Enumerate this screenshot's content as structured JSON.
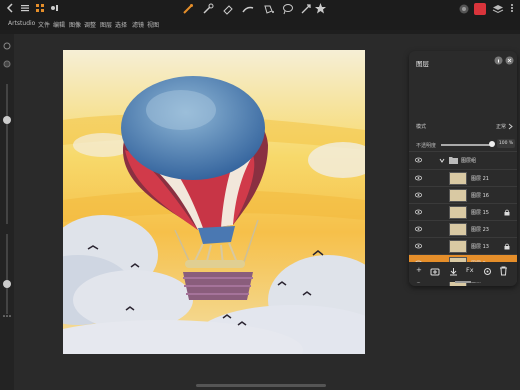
{
  "app": {
    "name": "Artstudio"
  },
  "menu": {
    "items": [
      "Artstudio",
      "文件",
      "编辑",
      "图像",
      "调整",
      "图层",
      "选择",
      "滤镜",
      "视图"
    ]
  },
  "layers_panel": {
    "title": "图层",
    "mode_label": "模式",
    "mode_value": "正常",
    "opacity_label": "不透明度",
    "opacity_value": "100 %",
    "group_name": "图层组",
    "layers": [
      {
        "name": "图层 21",
        "locked": false,
        "selected": false
      },
      {
        "name": "图层 16",
        "locked": false,
        "selected": false
      },
      {
        "name": "图层 15",
        "locked": true,
        "selected": false
      },
      {
        "name": "图层 23",
        "locked": false,
        "selected": false
      },
      {
        "name": "图层 13",
        "locked": true,
        "selected": false
      },
      {
        "name": "图层 9",
        "locked": false,
        "selected": true
      },
      {
        "name": "图层 14",
        "locked": false,
        "selected": false
      },
      {
        "name": "图层 11",
        "locked": false,
        "selected": false
      }
    ],
    "bottom_fx": "Fx"
  },
  "colors": {
    "accent": "#e58e2a",
    "brand_red": "#d9343b",
    "panel_bg": "#2b2b2b"
  },
  "icons": {
    "top_tools": [
      "brush-icon",
      "smudge-icon",
      "eraser-icon",
      "fill-icon",
      "selection-icon",
      "transform-icon",
      "shape-star-icon"
    ],
    "layer_bottom": [
      "add-layer-icon",
      "add-group-icon",
      "import-icon",
      "fx-icon",
      "settings-icon",
      "delete-icon"
    ]
  }
}
